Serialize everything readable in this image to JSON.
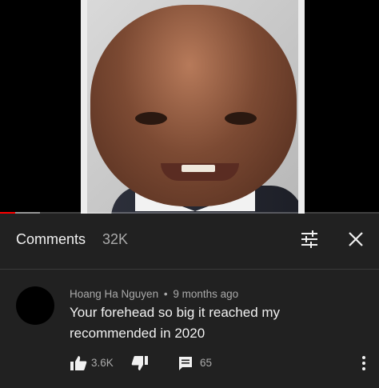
{
  "video": {
    "progress_played": 0.04,
    "progress_buffered_end": 0.105,
    "accent_color": "#ff0000"
  },
  "comments_panel": {
    "title": "Comments",
    "count": "32K",
    "icons": [
      "filter-icon",
      "close-icon"
    ]
  },
  "comment": {
    "author": "Hoang Ha Nguyen",
    "separator": "•",
    "time": "9 months ago",
    "text": "Your forehead so big it reached my recommended in 2020",
    "likes": "3.6K",
    "replies": "65",
    "icons": [
      "thumbs-up-icon",
      "thumbs-down-icon",
      "reply-icon",
      "more-vert-icon"
    ]
  }
}
